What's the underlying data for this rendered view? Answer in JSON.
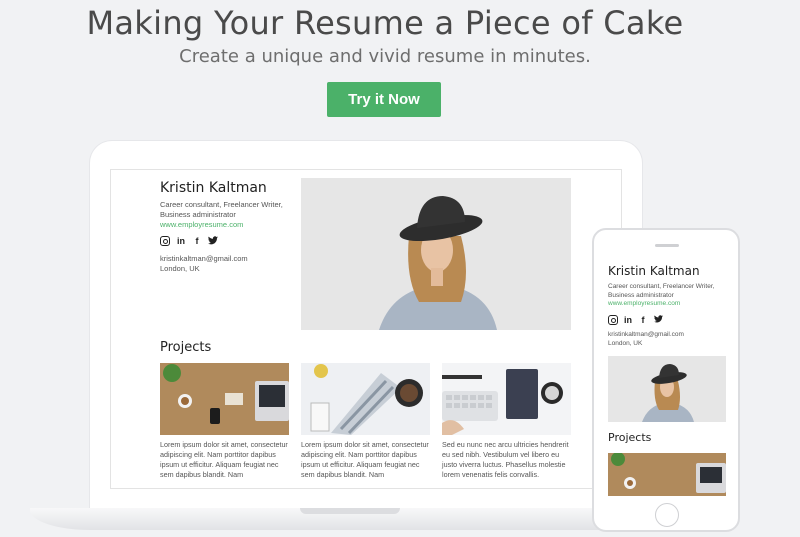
{
  "hero": {
    "title": "Making Your Resume a Piece of Cake",
    "subtitle": "Create a unique and vivid resume in minutes.",
    "cta_label": "Try it Now"
  },
  "resume": {
    "name": "Kristin Kaltman",
    "role": "Career consultant, Freelancer Writer, Business administrator",
    "site": "www.employresume.com",
    "socials": [
      "instagram-icon",
      "linkedin-icon",
      "facebook-icon",
      "twitter-icon"
    ],
    "social_glyphs": {
      "linkedin": "in",
      "facebook": "f",
      "twitter": "𝕥"
    },
    "email": "kristinkaltman@gmail.com",
    "location": "London, UK",
    "projects_heading": "Projects",
    "projects": [
      {
        "text": "Lorem ipsum dolor sit amet, consectetur adipiscing elit. Nam porttitor dapibus ipsum ut efficitur. Aliquam feugiat nec sem dapibus blandit. Nam"
      },
      {
        "text": "Lorem ipsum dolor sit amet, consectetur adipiscing elit. Nam porttitor dapibus ipsum ut efficitur. Aliquam feugiat nec sem dapibus blandit. Nam"
      },
      {
        "text": "Sed eu nunc nec arcu ultricies hendrerit eu sed nibh. Vestibulum vel libero eu justo viverra luctus. Phasellus molestie lorem venenatis felis convallis."
      }
    ]
  },
  "colors": {
    "accent": "#4bb169",
    "background": "#f1f2f4"
  }
}
